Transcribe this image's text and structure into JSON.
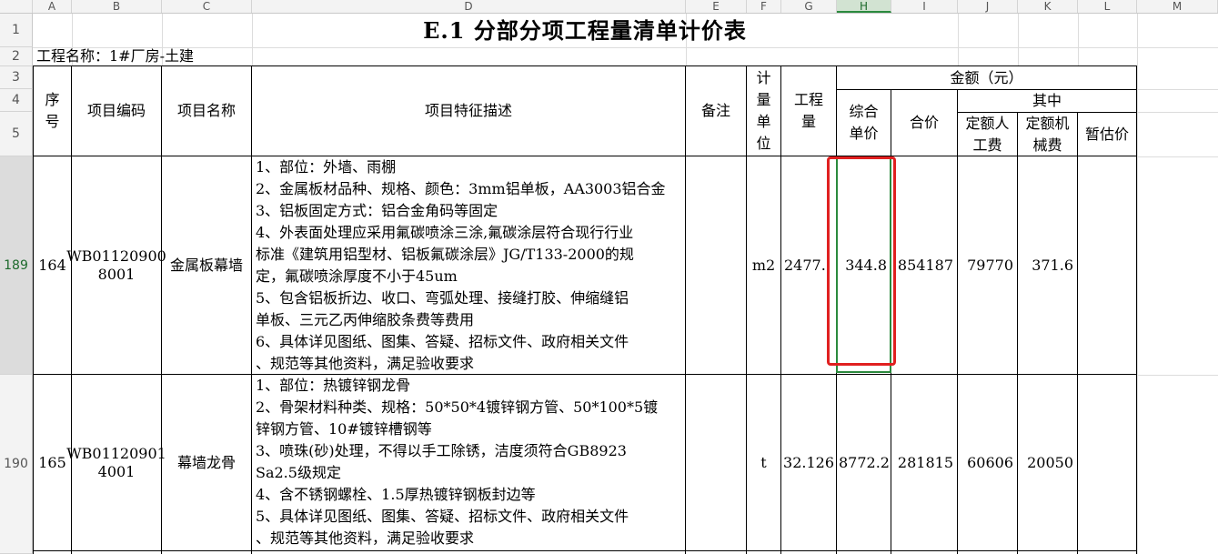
{
  "columns": [
    "A",
    "B",
    "C",
    "D",
    "E",
    "F",
    "G",
    "H",
    "I",
    "J",
    "K",
    "L",
    "M"
  ],
  "rows": [
    "1",
    "2",
    "3",
    "4",
    "5",
    "189",
    "190"
  ],
  "title": "E.1  分部分项工程量清单计价表",
  "project": "工程名称：1#厂房-土建",
  "headers": {
    "seq": "序号",
    "code": "项目编码",
    "name": "项目名称",
    "desc": "项目特征描述",
    "remark": "备注",
    "unit": "计量单位",
    "qty": "工程量",
    "amount": "金额（元）",
    "unit_price": "综合单价",
    "total": "合价",
    "of_which": "其中",
    "labor": "定额人工费",
    "machine": "定额机械费",
    "provisional": "暂估价"
  },
  "items": [
    {
      "seq": "164",
      "code": [
        "WB01120900",
        "8001"
      ],
      "name": "金属板幕墙",
      "desc": [
        "1、部位：外墙、雨棚",
        "2、金属板材品种、规格、颜色：3mm铝单板，AA3003铝合金",
        "3、铝板固定方式：铝合金角码等固定",
        "4、外表面处理应采用氟碳喷涂三涂,氟碳涂层符合现行行业",
        "标准《建筑用铝型材、铝板氟碳涂层》JG/T133-2000的规",
        "定，氟碳喷涂厚度不小于45um",
        "5、包含铝板折边、收口、弯弧处理、接缝打胶、伸缩缝铝",
        "单板、三元乙丙伸缩胶条费等费用",
        "6、具体详见图纸、图集、答疑、招标文件、政府相关文件",
        "、规范等其他资料，满足验收要求"
      ],
      "unit": "m2",
      "qty": "2477.",
      "unit_price": "344.8",
      "total": "854187",
      "labor": "79770",
      "machine": "371.6"
    },
    {
      "seq": "165",
      "code": [
        "WB01120901",
        "4001"
      ],
      "name": "幕墙龙骨",
      "desc": [
        "1、部位：热镀锌钢龙骨",
        "2、骨架材料种类、规格：50*50*4镀锌钢方管、50*100*5镀",
        "锌钢方管、10#镀锌槽钢等",
        "3、喷珠(砂)处理，不得以手工除锈，洁度须符合GB8923",
        "Sa2.5级规定",
        "4、含不锈钢螺栓、1.5厚热镀锌钢板封边等",
        "5、具体详见图纸、图集、答疑、招标文件、政府相关文件",
        "、规范等其他资料，满足验收要求"
      ],
      "unit": "t",
      "qty": "32.126",
      "unit_price": "8772.2",
      "total": "281815",
      "labor": "60606",
      "machine": "20050"
    }
  ]
}
